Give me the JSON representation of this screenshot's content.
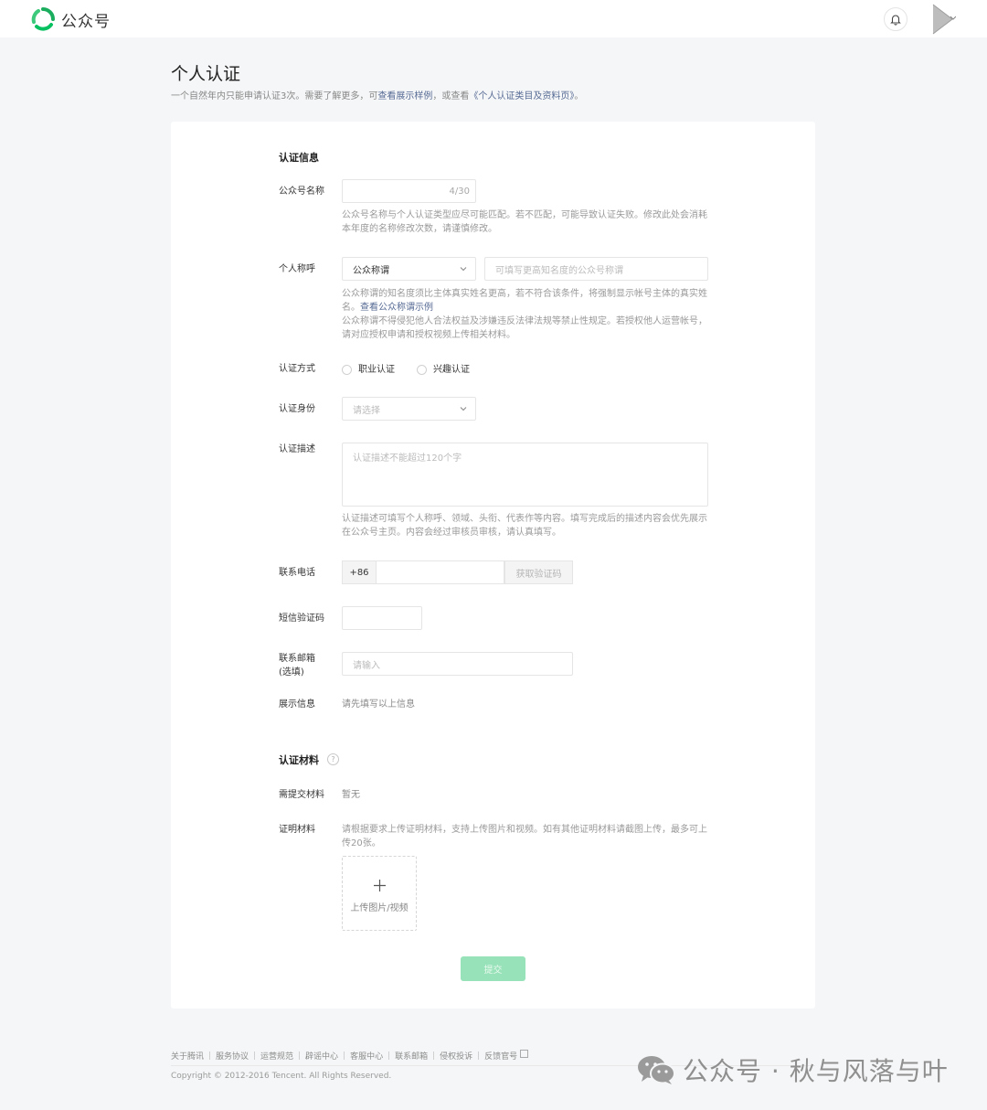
{
  "topbar": {
    "app_name": "公众号"
  },
  "header": {
    "title": "个人认证",
    "subtitle_prefix": "一个自然年内只能申请认证3次。需要了解更多，可",
    "subtitle_link1": "查看展示样例",
    "subtitle_mid": "，或查看",
    "subtitle_link2": "《个人认证类目及资料页》",
    "subtitle_end": "。"
  },
  "form": {
    "section_info": "认证信息",
    "name_label": "公众号名称",
    "name_counter": "4/30",
    "name_hint": "公众号名称与个人认证类型应尽可能匹配。若不匹配，可能导致认证失败。修改此处会消耗本年度的名称修改次数，请谨慎修改。",
    "nickname_label": "个人称呼",
    "nickname_select": "公众称谓",
    "nickname_placeholder": "可填写更高知名度的公众号称谓",
    "nickname_hint1": "公众称谓的知名度须比主体真实姓名更高，若不符合该条件，将强制显示帐号主体的真实姓名。",
    "nickname_hint_link": "查看公众称谓示例",
    "nickname_hint2": "公众称谓不得侵犯他人合法权益及涉嫌违反法律法规等禁止性规定。若授权他人运营帐号，请对应授权申请和授权视频上传相关材料。",
    "method_label": "认证方式",
    "method_option1": "职业认证",
    "method_option2": "兴趣认证",
    "identity_label": "认证身份",
    "identity_placeholder": "请选择",
    "desc_label": "认证描述",
    "desc_placeholder": "认证描述不能超过120个字",
    "desc_hint": "认证描述可填写个人称呼、领域、头衔、代表作等内容。填写完成后的描述内容会优先展示在公众号主页。内容会经过审核员审核，请认真填写。",
    "phone_label": "联系电话",
    "phone_prefix": "+86",
    "phone_code_button": "获取验证码",
    "sms_label": "短信验证码",
    "email_label_line1": "联系邮箱",
    "email_label_line2": "(选填)",
    "email_placeholder": "请输入",
    "display_label": "展示信息",
    "display_value": "请先填写以上信息",
    "section_materials": "认证材料",
    "required_label": "需提交材料",
    "required_value": "暂无",
    "proof_label": "证明材料",
    "proof_hint": "请根据要求上传证明材料，支持上传图片和视频。如有其他证明材料请截图上传，最多可上传20张。",
    "upload_label": "上传图片/视频",
    "submit_label": "提交"
  },
  "footer": {
    "links": [
      "关于腾讯",
      "服务协议",
      "运营规范",
      "辟谣中心",
      "客服中心",
      "联系邮箱",
      "侵权投诉",
      "反馈官号"
    ],
    "copyright": "Copyright © 2012-2016 Tencent. All Rights Reserved."
  },
  "watermark": {
    "text": "公众号 · 秋与风落与叶"
  },
  "colors": {
    "brand_green": "#07c160",
    "link_blue": "#576b95",
    "submit_disabled": "#97e2b8"
  }
}
